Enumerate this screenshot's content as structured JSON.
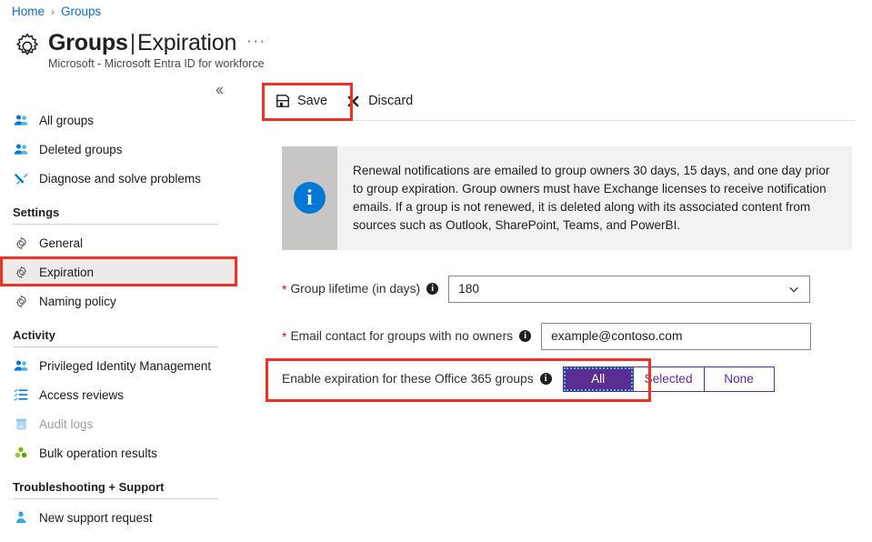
{
  "breadcrumb": {
    "items": [
      "Home",
      "Groups"
    ],
    "separator": "›"
  },
  "header": {
    "icon": "gear-icon",
    "title_bold": "Groups",
    "title_separator": "|",
    "title_light": "Expiration",
    "ellipsis": "···",
    "subtitle": "Microsoft - Microsoft Entra ID for workforce"
  },
  "sidebar": {
    "collapse_icon": "double-chevron-left-icon",
    "top_items": [
      {
        "label": "All groups",
        "icon": "people-icon",
        "selected": false,
        "disabled": false
      },
      {
        "label": "Deleted groups",
        "icon": "people-icon",
        "selected": false,
        "disabled": false
      },
      {
        "label": "Diagnose and solve problems",
        "icon": "wrench-icon",
        "selected": false,
        "disabled": false
      }
    ],
    "sections": [
      {
        "title": "Settings",
        "items": [
          {
            "label": "General",
            "icon": "gear-icon",
            "selected": false,
            "disabled": false
          },
          {
            "label": "Expiration",
            "icon": "gear-icon",
            "selected": true,
            "disabled": false
          },
          {
            "label": "Naming policy",
            "icon": "gear-icon",
            "selected": false,
            "disabled": false
          }
        ]
      },
      {
        "title": "Activity",
        "items": [
          {
            "label": "Privileged Identity Management",
            "icon": "people-icon",
            "selected": false,
            "disabled": false
          },
          {
            "label": "Access reviews",
            "icon": "checklist-icon",
            "selected": false,
            "disabled": false
          },
          {
            "label": "Audit logs",
            "icon": "book-icon",
            "selected": false,
            "disabled": true
          },
          {
            "label": "Bulk operation results",
            "icon": "clover-icon",
            "selected": false,
            "disabled": false
          }
        ]
      },
      {
        "title": "Troubleshooting + Support",
        "items": [
          {
            "label": "New support request",
            "icon": "person-support-icon",
            "selected": false,
            "disabled": false
          }
        ]
      }
    ]
  },
  "toolbar": {
    "save_label": "Save",
    "save_icon": "save-floppy-icon",
    "discard_label": "Discard",
    "discard_icon": "close-x-icon"
  },
  "info_banner": {
    "icon": "info-circle-icon",
    "text": "Renewal notifications are emailed to group owners 30 days, 15 days, and one day prior to group expiration. Group owners must have Exchange licenses to receive notification emails. If a group is not renewed, it is deleted along with its associated content from sources such as Outlook, SharePoint, Teams, and PowerBI."
  },
  "form": {
    "group_lifetime": {
      "required_marker": "*",
      "label": "Group lifetime (in days)",
      "info_icon": "info-dot-icon",
      "info_glyph": "i",
      "value": "180",
      "chevron_icon": "chevron-down-icon"
    },
    "email_contact": {
      "required_marker": "*",
      "label": "Email contact for groups with no owners",
      "info_icon": "info-dot-icon",
      "info_glyph": "i",
      "value": "example@contoso.com",
      "placeholder": "example@contoso.com"
    },
    "enable_expiration": {
      "label": "Enable expiration for these Office 365 groups",
      "info_icon": "info-dot-icon",
      "info_glyph": "i",
      "options": [
        "All",
        "Selected",
        "None"
      ],
      "selected": "All"
    }
  },
  "colors": {
    "accent_blue": "#0f6cbd",
    "info_blue": "#0078d4",
    "purple": "#5c2d91",
    "focus_cyan": "#30c9e8",
    "annotation_red": "#ef3124",
    "required_red": "#a4262c",
    "selected_row_bg": "#edebe9",
    "banner_bg": "#f3f2f1",
    "banner_strip": "#c8c6c4"
  },
  "annotations": [
    {
      "name": "save-button-highlight"
    },
    {
      "name": "expiration-nav-highlight"
    },
    {
      "name": "enable-expiration-highlight"
    }
  ]
}
